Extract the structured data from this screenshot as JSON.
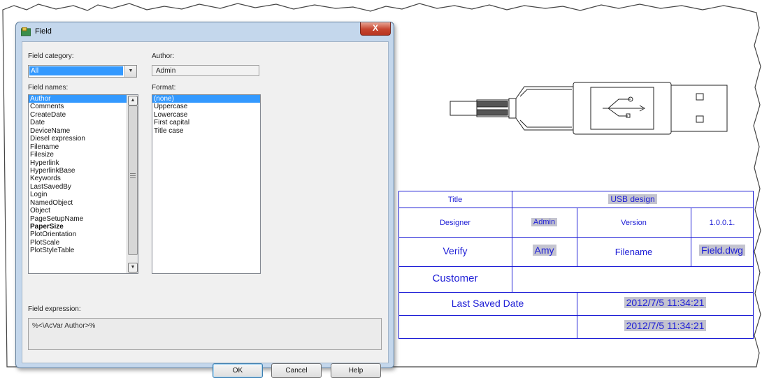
{
  "dialog": {
    "title": "Field",
    "close_label": "X",
    "field_category_label": "Field category:",
    "field_category_value": "All",
    "author_label": "Author:",
    "author_value": "Admin",
    "field_names_label": "Field names:",
    "field_names": [
      "Author",
      "Comments",
      "CreateDate",
      "Date",
      "DeviceName",
      "Diesel expression",
      "Filename",
      "Filesize",
      "Hyperlink",
      "HyperlinkBase",
      "Keywords",
      "LastSavedBy",
      "Login",
      "NamedObject",
      "Object",
      "PageSetupName",
      "PaperSize",
      "PlotOrientation",
      "PlotScale",
      "PlotStyleTable"
    ],
    "field_names_selected": "Author",
    "format_label": "Format:",
    "formats": [
      "(none)",
      "Uppercase",
      "Lowercase",
      "First capital",
      "Title case"
    ],
    "format_selected": "(none)",
    "field_expression_label": "Field expression:",
    "field_expression_value": "%<\\AcVar Author>%",
    "ok_label": "OK",
    "cancel_label": "Cancel",
    "help_label": "Help"
  },
  "title_block": {
    "title_label": "Title",
    "title_value": "USB design",
    "designer_label": "Designer",
    "designer_value": "Admin",
    "version_label": "Version",
    "version_value": "1.0.0.1.",
    "verify_label": "Verify",
    "verify_value": "Amy",
    "filename_label": "Filename",
    "filename_value": "Field.dwg",
    "customer_label": "Customer",
    "last_saved_label": "Last Saved Date",
    "last_saved_value": "2012/7/5 11:34:21",
    "extra_date_value": "2012/7/5 11:34:21"
  },
  "colors": {
    "cad_text": "#1d1dd6",
    "cad_line": "#1d1dd6",
    "field_highlight": "#c3c3cf",
    "selection": "#3399ff"
  }
}
